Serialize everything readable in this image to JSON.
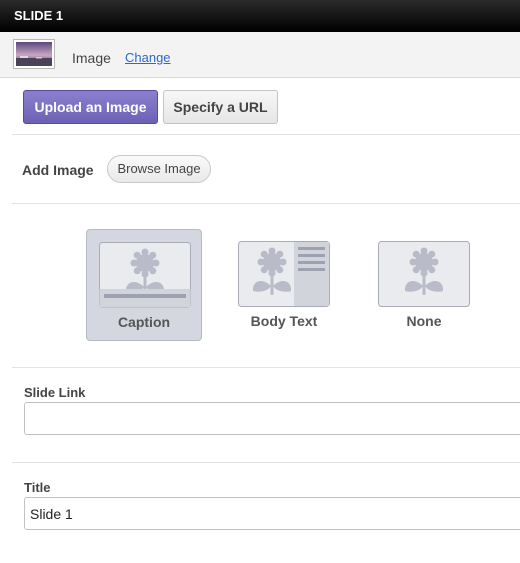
{
  "header": {
    "title": "SLIDE 1"
  },
  "image_bar": {
    "label": "Image",
    "change_link": "Change"
  },
  "source_tabs": {
    "upload_label": "Upload an Image",
    "url_label": "Specify a URL"
  },
  "add_image": {
    "label": "Add Image",
    "browse_label": "Browse Image"
  },
  "layout_options": [
    {
      "label": "Caption",
      "selected": true,
      "icon": "flower-caption-icon"
    },
    {
      "label": "Body Text",
      "selected": false,
      "icon": "flower-body-text-icon"
    },
    {
      "label": "None",
      "selected": false,
      "icon": "flower-icon"
    }
  ],
  "slide_link": {
    "label": "Slide Link",
    "value": ""
  },
  "title_field": {
    "label": "Title",
    "value": "Slide 1"
  },
  "colors": {
    "accent": "#7469c0",
    "header_bg": "#000000",
    "selected_option_bg": "#d4d7e0"
  }
}
